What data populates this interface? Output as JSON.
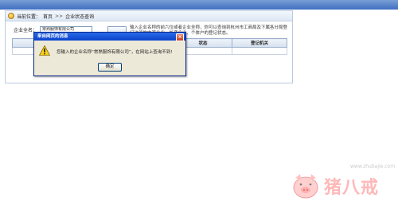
{
  "breadcrumb": {
    "prefix": "当前位置：",
    "home": "首页",
    "sep": ">>",
    "current": "企业状态查询"
  },
  "form": {
    "label": "企业全名：",
    "value": "常熟服饰有限公司"
  },
  "hint_text": "输入企业名称的前六位或者企业全称，你可以查询到杭州市工商局及下属各分局登记注册的内资企业、外资企业、个体户的登记状态。",
  "table": {
    "headers": [
      "",
      "状态",
      "登记机关"
    ]
  },
  "dialog": {
    "title": "来自网页的消息",
    "message": "您输入的企业名称“常熟服饰有限公司”，在网站上查询不到!",
    "ok_label": "确定",
    "icon": "warning-icon"
  },
  "watermark": {
    "brand": "猪八戒",
    "url": "www.zhubajie.com"
  },
  "colors": {
    "titlebar": "#0a43c9",
    "dialog_bg": "#ece9d8",
    "watermark": "#ffb8b8"
  }
}
